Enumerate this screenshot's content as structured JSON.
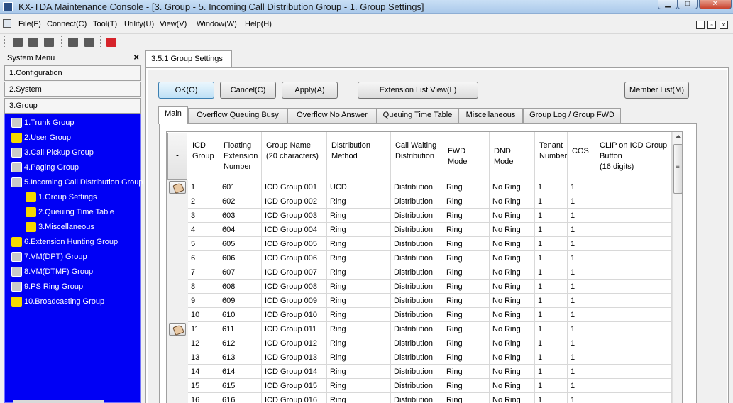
{
  "window": {
    "title": "KX-TDA Maintenance Console - [3. Group - 5. Incoming Call Distribution Group - 1. Group Settings]"
  },
  "menu": [
    "File(F)",
    "Connect(C)",
    "Tool(T)",
    "Utility(U)",
    "View(V)",
    "Window(W)",
    "Help(H)"
  ],
  "left": {
    "header": "System Menu",
    "close": "×",
    "categories": [
      "1.Configuration",
      "2.System",
      "3.Group"
    ],
    "tree": [
      "1.Trunk Group",
      "2.User Group",
      "3.Call Pickup Group",
      "4.Paging Group",
      "5.Incoming Call Distribution Group",
      "1.Group Settings",
      "2.Queuing Time Table",
      "3.Miscellaneous",
      "6.Extension Hunting Group",
      "7.VM(DPT) Group",
      "8.VM(DTMF) Group",
      "9.PS Ring Group",
      "10.Broadcasting Group"
    ]
  },
  "doc_tab": "3.5.1 Group Settings",
  "buttons": {
    "ok": "OK(O)",
    "cancel": "Cancel(C)",
    "apply": "Apply(A)",
    "ext_list": "Extension List View(L)",
    "member_list": "Member List(M)"
  },
  "tabs": [
    "Main",
    "Overflow Queuing Busy",
    "Overflow No Answer",
    "Queuing Time Table",
    "Miscellaneous",
    "Group Log / Group FWD"
  ],
  "grid": {
    "corner": "-",
    "headers": [
      [
        "ICD",
        "Group"
      ],
      [
        "Floating",
        "Extension",
        "Number"
      ],
      [
        "Group Name",
        "(20 characters)"
      ],
      [
        "Distribution",
        "Method"
      ],
      [
        "Call Waiting",
        "Distribution"
      ],
      [
        "FWD Mode"
      ],
      [
        "DND Mode"
      ],
      [
        "Tenant",
        "Number"
      ],
      [
        "COS"
      ],
      [
        "CLIP on ICD Group",
        "Button",
        "(16 digits)"
      ]
    ],
    "rows": [
      [
        "1",
        "601",
        "ICD Group 001",
        "UCD",
        "Distribution",
        "Ring",
        "No Ring",
        "1",
        "1",
        ""
      ],
      [
        "2",
        "602",
        "ICD Group 002",
        "Ring",
        "Distribution",
        "Ring",
        "No Ring",
        "1",
        "1",
        ""
      ],
      [
        "3",
        "603",
        "ICD Group 003",
        "Ring",
        "Distribution",
        "Ring",
        "No Ring",
        "1",
        "1",
        ""
      ],
      [
        "4",
        "604",
        "ICD Group 004",
        "Ring",
        "Distribution",
        "Ring",
        "No Ring",
        "1",
        "1",
        ""
      ],
      [
        "5",
        "605",
        "ICD Group 005",
        "Ring",
        "Distribution",
        "Ring",
        "No Ring",
        "1",
        "1",
        ""
      ],
      [
        "6",
        "606",
        "ICD Group 006",
        "Ring",
        "Distribution",
        "Ring",
        "No Ring",
        "1",
        "1",
        ""
      ],
      [
        "7",
        "607",
        "ICD Group 007",
        "Ring",
        "Distribution",
        "Ring",
        "No Ring",
        "1",
        "1",
        ""
      ],
      [
        "8",
        "608",
        "ICD Group 008",
        "Ring",
        "Distribution",
        "Ring",
        "No Ring",
        "1",
        "1",
        ""
      ],
      [
        "9",
        "609",
        "ICD Group 009",
        "Ring",
        "Distribution",
        "Ring",
        "No Ring",
        "1",
        "1",
        ""
      ],
      [
        "10",
        "610",
        "ICD Group 010",
        "Ring",
        "Distribution",
        "Ring",
        "No Ring",
        "1",
        "1",
        ""
      ],
      [
        "11",
        "611",
        "ICD Group 011",
        "Ring",
        "Distribution",
        "Ring",
        "No Ring",
        "1",
        "1",
        ""
      ],
      [
        "12",
        "612",
        "ICD Group 012",
        "Ring",
        "Distribution",
        "Ring",
        "No Ring",
        "1",
        "1",
        ""
      ],
      [
        "13",
        "613",
        "ICD Group 013",
        "Ring",
        "Distribution",
        "Ring",
        "No Ring",
        "1",
        "1",
        ""
      ],
      [
        "14",
        "614",
        "ICD Group 014",
        "Ring",
        "Distribution",
        "Ring",
        "No Ring",
        "1",
        "1",
        ""
      ],
      [
        "15",
        "615",
        "ICD Group 015",
        "Ring",
        "Distribution",
        "Ring",
        "No Ring",
        "1",
        "1",
        ""
      ],
      [
        "16",
        "616",
        "ICD Group 016",
        "Ring",
        "Distribution",
        "Ring",
        "No Ring",
        "1",
        "1",
        ""
      ]
    ]
  }
}
